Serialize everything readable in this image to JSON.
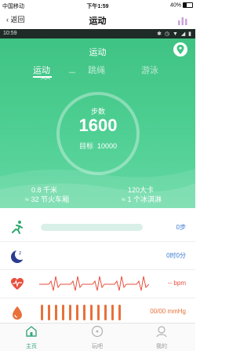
{
  "ios_status": {
    "carrier": "中国移动",
    "time": "下午1:59",
    "battery": "40%"
  },
  "navbar": {
    "back_label": "返回",
    "title": "运动"
  },
  "android_status": {
    "time": "10:59"
  },
  "header": {
    "title": "运动",
    "tabs": [
      {
        "label": "运动",
        "active": true
      },
      {
        "label": "跳绳",
        "active": false
      },
      {
        "label": "游泳",
        "active": false
      }
    ]
  },
  "steps": {
    "label": "步数",
    "value": "1600",
    "goal_label": "目标",
    "goal_value": "10000"
  },
  "stats": {
    "distance_value": "0.8",
    "distance_unit": "千米",
    "distance_equiv": "≈ 32 节火车厢",
    "calories_value": "120",
    "calories_unit": "大卡",
    "calories_equiv": "≈ 1 个冰淇淋"
  },
  "rows": [
    {
      "name": "steps",
      "value": "0步",
      "progress": 0
    },
    {
      "name": "sleep",
      "value": "0时0分"
    },
    {
      "name": "heart-rate",
      "value": "-- bpm"
    },
    {
      "name": "blood-pressure",
      "value": "00/00 mmHg"
    }
  ],
  "tabbar": [
    {
      "label": "主页",
      "active": true
    },
    {
      "label": "玩吧",
      "active": false
    },
    {
      "label": "我的",
      "active": false
    }
  ],
  "colors": {
    "brand_green": "#3fc384",
    "accent_blue": "#3a7bd5",
    "heart_red": "#e94e3c",
    "bp_orange": "#e8713a"
  }
}
